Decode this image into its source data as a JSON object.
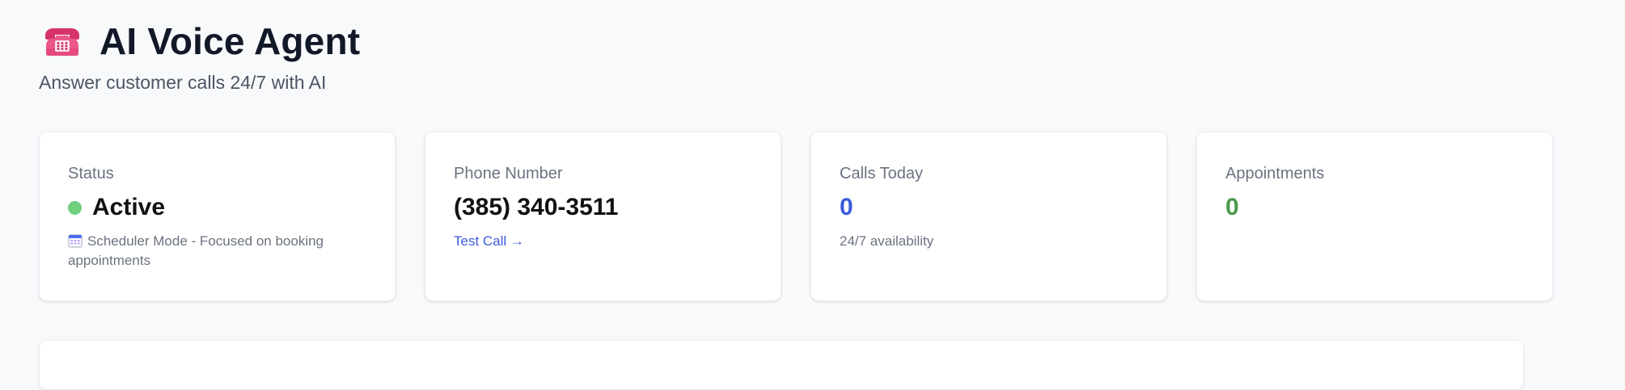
{
  "header": {
    "icon": "telephone-icon",
    "title": "AI Voice Agent",
    "subtitle": "Answer customer calls 24/7 with AI"
  },
  "cards": {
    "status": {
      "label": "Status",
      "value": "Active",
      "note": "Scheduler Mode - Focused on booking appointments",
      "note_icon": "calendar-icon",
      "dot_color": "#6fcf7c"
    },
    "phone": {
      "label": "Phone Number",
      "value": "(385) 340-3511",
      "link": "Test Call →"
    },
    "calls": {
      "label": "Calls Today",
      "value": "0",
      "note": "24/7 availability",
      "value_color": "#3b5bdb"
    },
    "appointments": {
      "label": "Appointments",
      "value": "0",
      "value_color": "#4a9a4e"
    }
  }
}
